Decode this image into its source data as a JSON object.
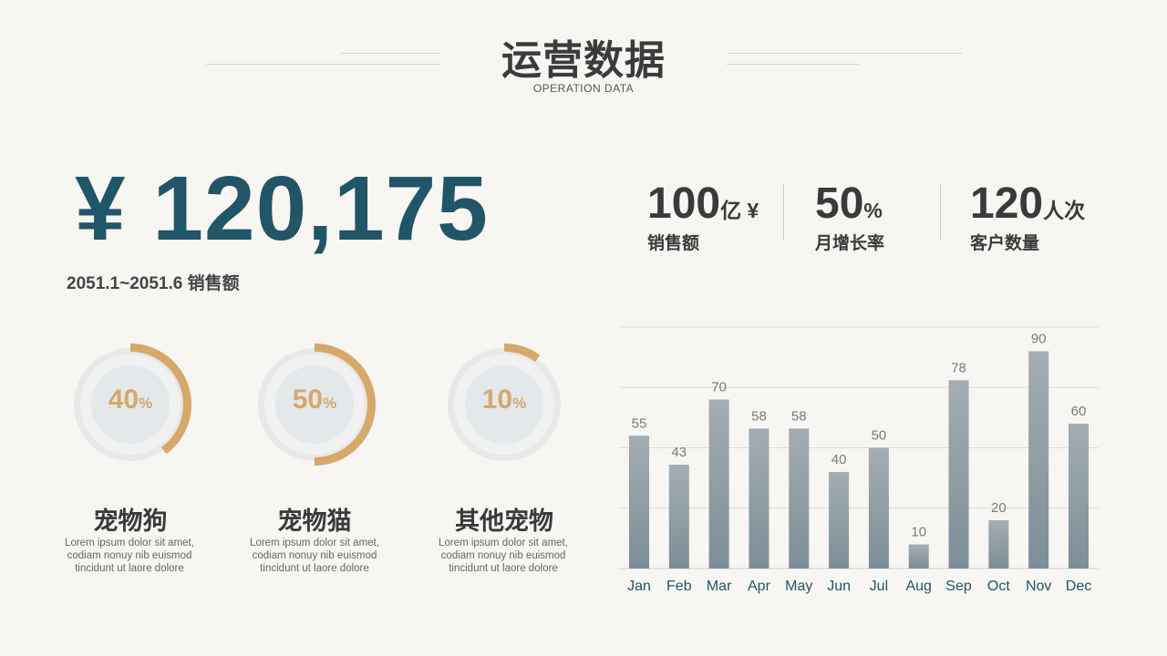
{
  "header": {
    "title": "运营数据",
    "subtitle": "OPERATION DATA"
  },
  "headline": {
    "amount": "¥ 120,175",
    "caption": "2051.1~2051.6 销售额"
  },
  "stats": [
    {
      "value": "100",
      "unit": "亿 ¥",
      "label": "销售额"
    },
    {
      "value": "50",
      "unit": "%",
      "label": "月增长率"
    },
    {
      "value": "120",
      "unit": "人次",
      "label": "客户数量"
    }
  ],
  "categories": [
    {
      "value": "40",
      "pct": "%",
      "fraction": 0.4,
      "name": "宠物狗",
      "desc": [
        "Lorem ipsum dolor sit amet,",
        "codiam nonuy nib euismod",
        "tincidunt ut laore dolore"
      ]
    },
    {
      "value": "50",
      "pct": "%",
      "fraction": 0.5,
      "name": "宠物猫",
      "desc": [
        "Lorem ipsum dolor sit amet,",
        "codiam nonuy nib euismod",
        "tincidunt ut laore dolore"
      ]
    },
    {
      "value": "10",
      "pct": "%",
      "fraction": 0.1,
      "name": "其他宠物",
      "desc": [
        "Lorem ipsum dolor sit amet,",
        "codiam nonuy nib euismod",
        "tincidunt ut laore dolore"
      ]
    }
  ],
  "colors": {
    "accent": "#d6a86a",
    "headline": "#215568",
    "ring_track": "#e8e8e8",
    "ring_inner": "#f1f1f1",
    "ring_core": "#e3e8eb",
    "bar_top": "#a3adb2",
    "bar_bottom": "#7d8e97",
    "axis_label": "#215568"
  },
  "chart_data": {
    "type": "bar",
    "categories": [
      "Jan",
      "Feb",
      "Mar",
      "Apr",
      "May",
      "Jun",
      "Jul",
      "Aug",
      "Sep",
      "Oct",
      "Nov",
      "Dec"
    ],
    "values": [
      55,
      43,
      70,
      58,
      58,
      40,
      50,
      10,
      78,
      20,
      90,
      60
    ],
    "title": "",
    "xlabel": "",
    "ylabel": "",
    "ylim": [
      0,
      100
    ],
    "grid": true,
    "data_labels": true
  }
}
